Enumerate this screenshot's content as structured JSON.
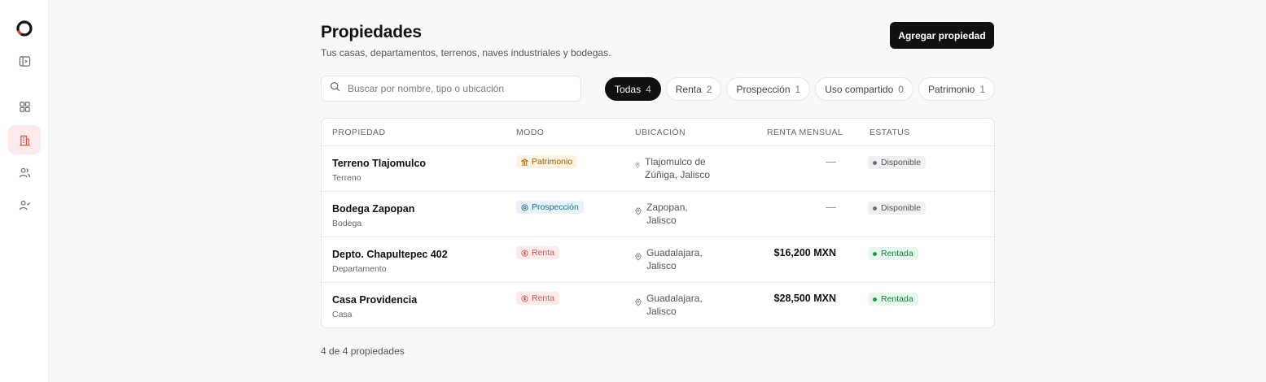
{
  "sidebar": {
    "icons": [
      "logo-icon",
      "panel-toggle-icon",
      "dashboard-icon",
      "building-icon",
      "users-icon",
      "user-check-icon"
    ],
    "accent": "#d9534f"
  },
  "header": {
    "title": "Propiedades",
    "subtitle": "Tus casas, departamentos, terrenos, naves industriales y bodegas.",
    "add_button": "Agregar propiedad"
  },
  "search": {
    "placeholder": "Buscar por nombre, tipo o ubicación"
  },
  "filters": [
    {
      "label": "Todas",
      "count": "4",
      "active": true
    },
    {
      "label": "Renta",
      "count": "2",
      "active": false
    },
    {
      "label": "Prospección",
      "count": "1",
      "active": false
    },
    {
      "label": "Uso compartido",
      "count": "0",
      "active": false
    },
    {
      "label": "Patrimonio",
      "count": "1",
      "active": false
    }
  ],
  "table": {
    "columns": [
      "PROPIEDAD",
      "MODO",
      "UBICACIÓN",
      "RENTA MENSUAL",
      "ESTATUS"
    ],
    "rows": [
      {
        "name": "Terreno Tlajomulco",
        "type": "Terreno",
        "mode": "Patrimonio",
        "mode_class": "patrimonio",
        "location": "Tlajomulco de Zúñiga, Jalisco",
        "rent": "—",
        "status": "Disponible",
        "status_class": "disponible"
      },
      {
        "name": "Bodega Zapopan",
        "type": "Bodega",
        "mode": "Prospección",
        "mode_class": "prospeccion",
        "location": "Zapopan, Jalisco",
        "rent": "—",
        "status": "Disponible",
        "status_class": "disponible"
      },
      {
        "name": "Depto. Chapultepec 402",
        "type": "Departamento",
        "mode": "Renta",
        "mode_class": "renta",
        "location": "Guadalajara, Jalisco",
        "rent": "$16,200 MXN",
        "status": "Rentada",
        "status_class": "rentada"
      },
      {
        "name": "Casa Providencia",
        "type": "Casa",
        "mode": "Renta",
        "mode_class": "renta",
        "location": "Guadalajara, Jalisco",
        "rent": "$28,500 MXN",
        "status": "Rentada",
        "status_class": "rentada"
      }
    ]
  },
  "footer": {
    "count_text": "4 de 4 propiedades"
  }
}
